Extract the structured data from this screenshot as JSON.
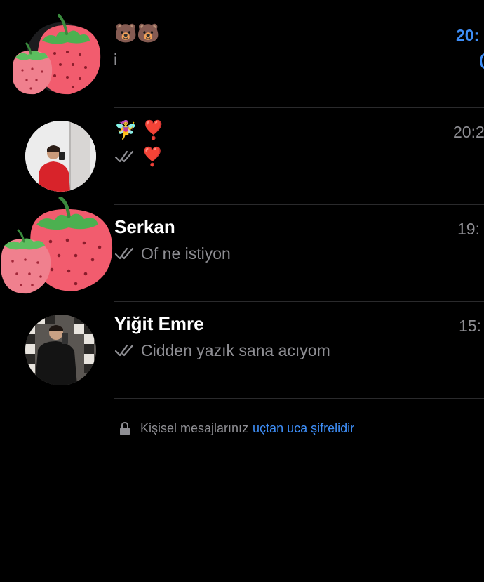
{
  "chats": [
    {
      "title": "🐻🐻",
      "time": "20:",
      "preview": "i",
      "unread": true,
      "avatar": "strawberry-icon",
      "delivered": false
    },
    {
      "title": "🧚‍♀️ ❣️",
      "time": "20:2",
      "preview": "❣️",
      "unread": false,
      "avatar": "profile-photo",
      "delivered": true
    },
    {
      "title": "Serkan",
      "time": "19:",
      "preview": "Of ne istiyon",
      "unread": false,
      "avatar": "strawberry-icon",
      "delivered": true
    },
    {
      "title": "Yiğit Emre",
      "time": "15:",
      "preview": "Cidden yazık sana acıyom",
      "unread": false,
      "avatar": "profile-photo",
      "delivered": true
    }
  ],
  "footer": {
    "text": "Kişisel mesajlarınız",
    "link": "uçtan uca şifrelidir"
  },
  "colors": {
    "background": "#000000",
    "accent": "#3e8ef7",
    "muted": "#8e8e93",
    "strawberry": "#f25c6e"
  }
}
